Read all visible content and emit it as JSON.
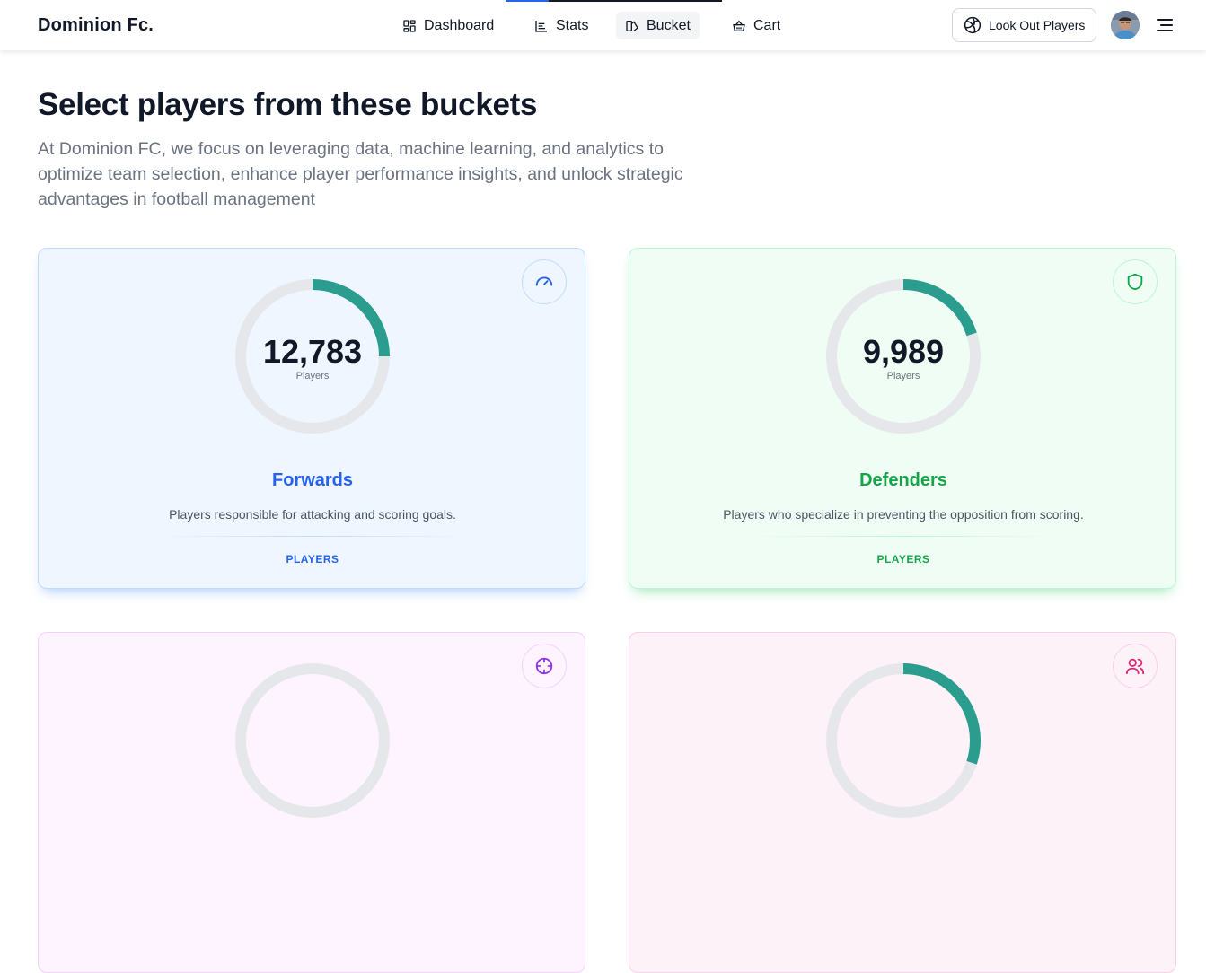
{
  "header": {
    "brand": "Dominion Fc.",
    "nav": [
      {
        "label": "Dashboard",
        "icon": "dashboard-icon"
      },
      {
        "label": "Stats",
        "icon": "stats-icon"
      },
      {
        "label": "Bucket",
        "icon": "bucket-icon",
        "active": true
      },
      {
        "label": "Cart",
        "icon": "cart-icon"
      }
    ],
    "lookout_label": "Look Out Players",
    "lookout_icon": "volleyball-icon",
    "page_load_progress": 0.2
  },
  "main": {
    "title": "Select players from these buckets",
    "subtitle": "At Dominion FC, we focus on leveraging data, machine learning, and analytics to optimize team selection, enhance player performance insights, and unlock strategic advantages in football management"
  },
  "buckets": [
    {
      "name": "Forwards",
      "count": "12,783",
      "count_label": "Players",
      "description": "Players responsible for attacking and scoring goals.",
      "link_label": "PLAYERS",
      "icon": "gauge-icon",
      "fill_fraction": 0.25,
      "accent": "#2563eb",
      "background": "#eff6ff",
      "border": "#bfdbfe",
      "ring_color": "#2a9d8f"
    },
    {
      "name": "Defenders",
      "count": "9,989",
      "count_label": "Players",
      "description": "Players who specialize in preventing the opposition from scoring.",
      "link_label": "PLAYERS",
      "icon": "shield-icon",
      "fill_fraction": 0.2,
      "accent": "#16a34a",
      "background": "#f0fdf4",
      "border": "#bbf7d0",
      "ring_color": "#2a9d8f"
    },
    {
      "name": "",
      "icon": "crosshair-icon",
      "accent": "#9333ea",
      "background": "#fdf4ff",
      "border": "#f5d0fe"
    },
    {
      "name": "",
      "icon": "users-icon",
      "fill_fraction": 0.3,
      "accent": "#db2777",
      "background": "#fdf2f8",
      "border": "#fbcfe8",
      "ring_color": "#2a9d8f"
    }
  ]
}
